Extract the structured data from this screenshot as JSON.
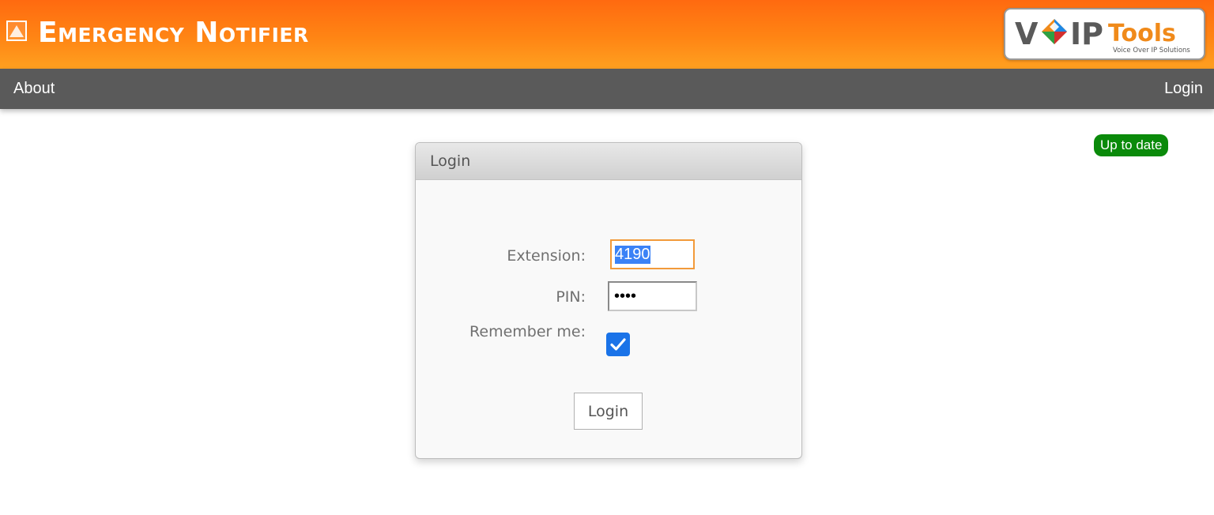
{
  "header": {
    "app_title": "Emergency Notifier",
    "app_icon": "warning-triangle-icon",
    "brand": {
      "name_part1": "V",
      "name_part2": "IP",
      "name_part3": "Tools",
      "tagline": "Voice Over IP Solutions"
    },
    "colors": {
      "gradient_top": "#ff6a10",
      "gradient_bottom": "#ffa020"
    }
  },
  "nav": {
    "about_label": "About",
    "login_label": "Login",
    "background": "#5a5a5a"
  },
  "status": {
    "label": "Up to date",
    "color": "#0a8a0a"
  },
  "login_panel": {
    "title": "Login",
    "extension": {
      "label": "Extension:",
      "value": "4190"
    },
    "pin": {
      "label": "PIN:",
      "value": "••••"
    },
    "remember": {
      "label": "Remember me:",
      "checked": true
    },
    "submit_label": "Login"
  }
}
